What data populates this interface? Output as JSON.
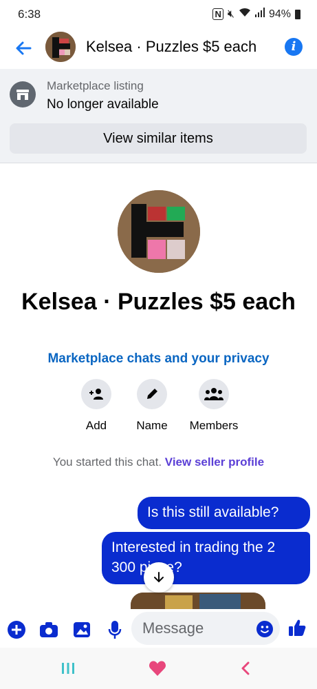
{
  "status_bar": {
    "time": "6:38",
    "battery": "94%"
  },
  "header": {
    "title": "Kelsea · Puzzles $5 each"
  },
  "listing": {
    "label": "Marketplace listing",
    "status": "No longer available",
    "similar_button": "View similar items"
  },
  "profile": {
    "name": "Kelsea · Puzzles $5 each",
    "privacy_link": "Marketplace chats and your privacy",
    "actions": [
      {
        "label": "Add",
        "icon": "add-person-icon"
      },
      {
        "label": "Name",
        "icon": "pencil-icon"
      },
      {
        "label": "Members",
        "icon": "members-icon"
      }
    ]
  },
  "chat": {
    "system_text": "You started this chat.",
    "system_link": "View seller profile",
    "messages": [
      {
        "text": "Is this still available?"
      },
      {
        "text": "Interested in trading the 2 300 piece?"
      }
    ]
  },
  "composer": {
    "placeholder": "Message"
  },
  "colors": {
    "accent": "#1877f2",
    "bubble": "#0a2ccf",
    "link": "#0a66c2",
    "nav_heart": "#e8477c"
  }
}
